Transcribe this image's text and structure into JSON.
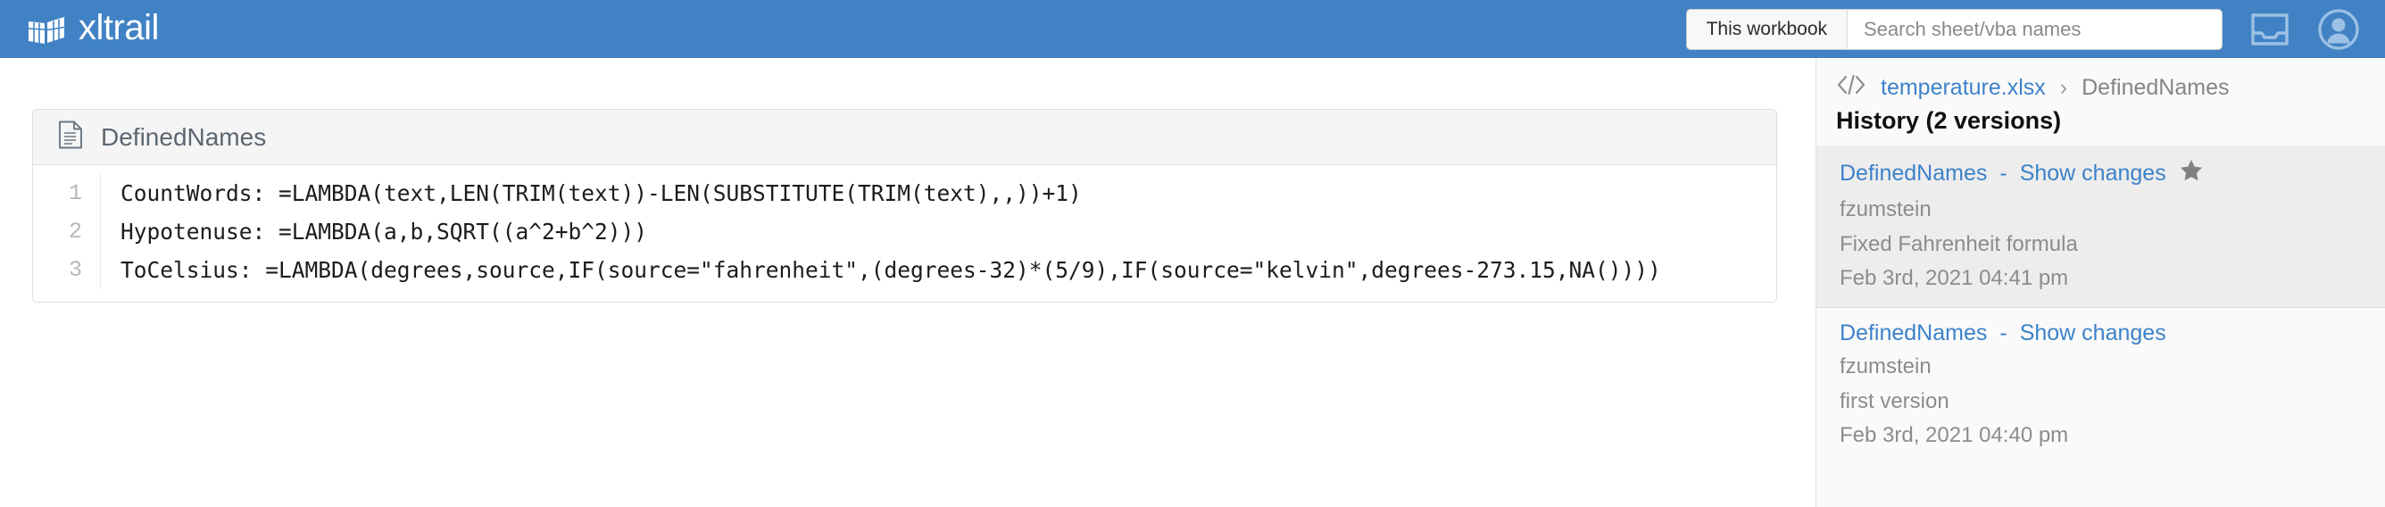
{
  "navbar": {
    "brand": "xltrail",
    "brand_icon": "spreadsheet-grid-logo",
    "scope_button": "This workbook",
    "search_placeholder": "Search sheet/vba names",
    "search_value": "",
    "inbox_icon": "inbox-tray-icon",
    "account_icon": "user-avatar-icon",
    "background_color": "#4182c5"
  },
  "panel": {
    "icon": "document-icon",
    "title": "DefinedNames",
    "lines": [
      {
        "number": "1",
        "code": "CountWords: =LAMBDA(text,LEN(TRIM(text))-LEN(SUBSTITUTE(TRIM(text),,))+1)"
      },
      {
        "number": "2",
        "code": "Hypotenuse: =LAMBDA(a,b,SQRT((a^2+b^2)))"
      },
      {
        "number": "3",
        "code": "ToCelsius: =LAMBDA(degrees,source,IF(source=\"fahrenheit\",(degrees-32)*(5/9),IF(source=\"kelvin\",degrees-273.15,NA())))"
      }
    ]
  },
  "sidebar": {
    "breadcrumb": {
      "icon": "code-brackets-icon",
      "file": "temperature.xlsx",
      "separator": "›",
      "current": "DefinedNames"
    },
    "history_title": "History (2 versions)",
    "versions": [
      {
        "name": "DefinedNames",
        "dash": "-",
        "action": "Show changes",
        "starred": true,
        "star_icon": "star-filled-icon",
        "author": "fzumstein",
        "message": "Fixed Fahrenheit formula",
        "timestamp": "Feb 3rd, 2021 04:41 pm"
      },
      {
        "name": "DefinedNames",
        "dash": "-",
        "action": "Show changes",
        "starred": false,
        "star_icon": "",
        "author": "fzumstein",
        "message": "first version",
        "timestamp": "Feb 3rd, 2021 04:40 pm"
      }
    ],
    "link_color": "#3d82c9",
    "highlight_color": "#ededed"
  }
}
